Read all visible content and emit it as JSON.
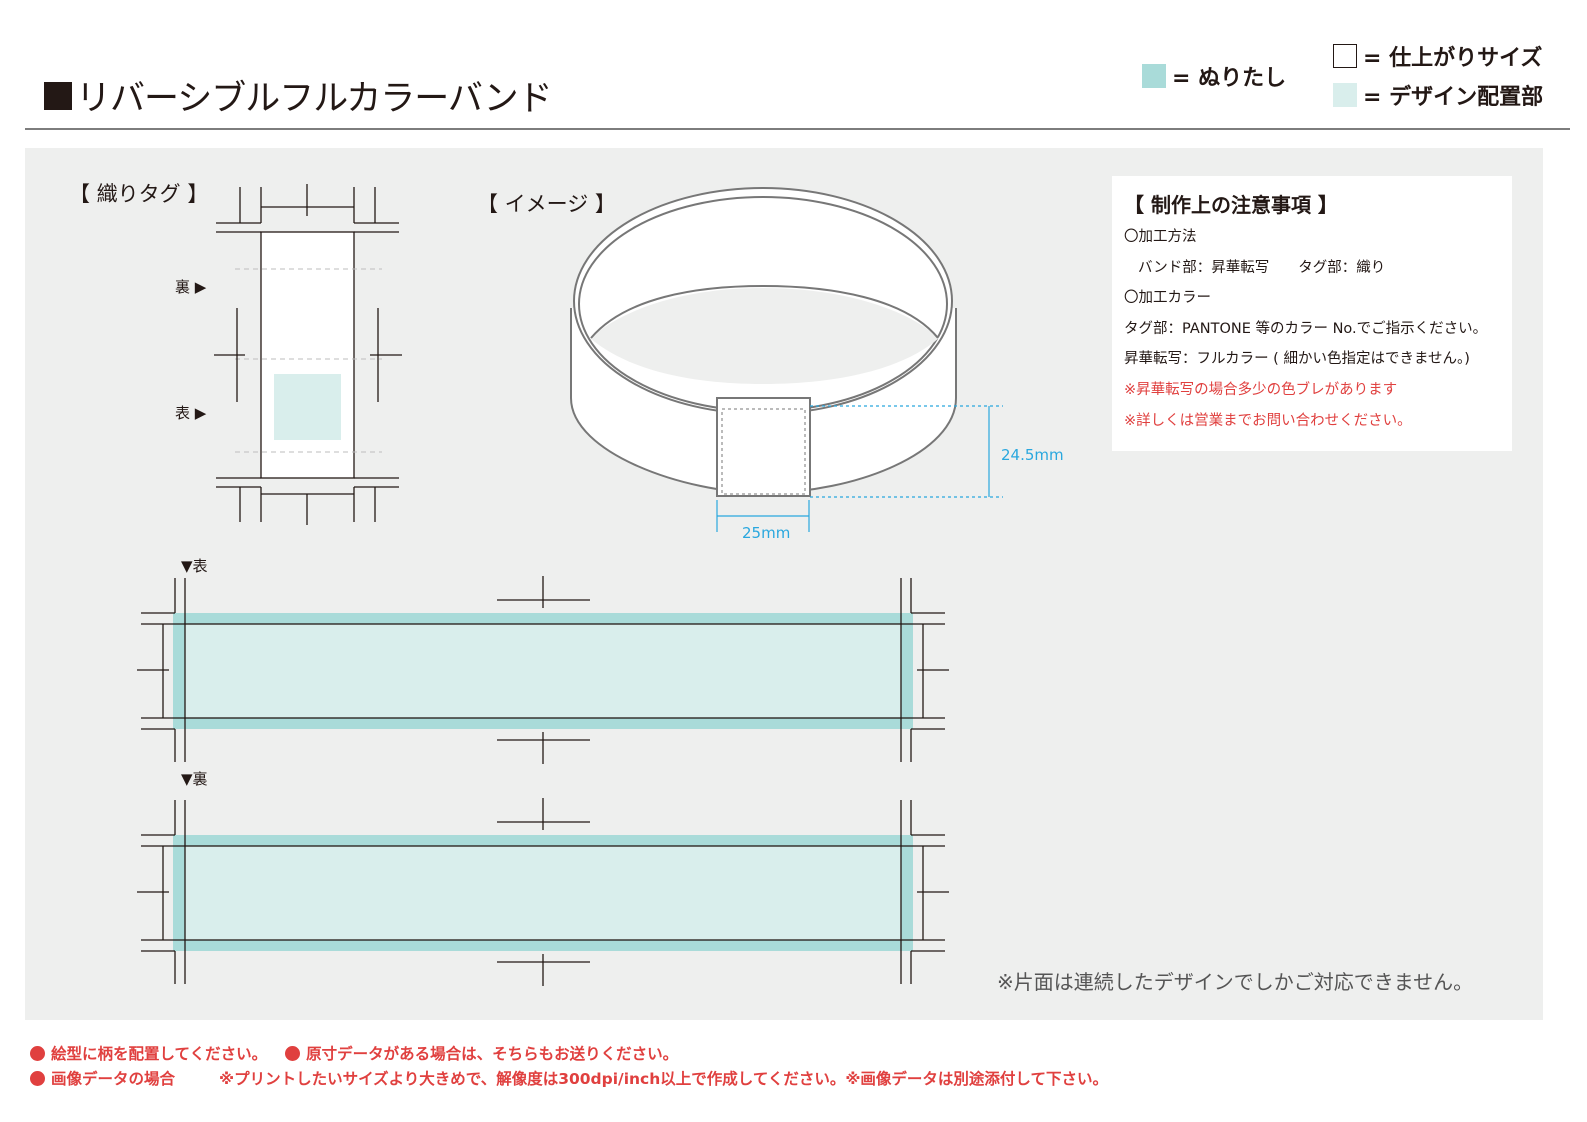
{
  "title": "リバーシブルフルカラーバンド",
  "legend": {
    "bleed": "= ぬりたし",
    "finish": "= 仕上がりサイズ",
    "design": "= デザイン配置部"
  },
  "colors": {
    "bleed": "#a9dbd9",
    "design": "#d9eeec",
    "panel": "#eeefee",
    "dimension": "#29a7de",
    "warning": "#e0403f"
  },
  "tag_section": {
    "title": "【 織りタグ 】",
    "back_label": "裏",
    "front_label": "表"
  },
  "image_section": {
    "title": "【 イメージ 】",
    "height_dim": "24.5mm",
    "width_dim": "25mm"
  },
  "notes": {
    "heading": "【 制作上の注意事項 】",
    "method_heading": "〇加工方法",
    "method_detail": "バンド部：昇華転写　　タグ部：織り",
    "color_heading": "〇加工カラー",
    "color_tag": "タグ部：PANTONE 等のカラー No.でご指示ください。",
    "color_sub": "昇華転写：フルカラー ( 細かい色指定はできません。)",
    "warn1": "※昇華転写の場合多少の色ブレがあります",
    "warn2": "※詳しくは営業までお問い合わせください。"
  },
  "bands": {
    "front_label": "▼表",
    "back_label": "▼裏"
  },
  "continuous_note": "※片面は連続したデザインでしかご対応できません。",
  "footer": {
    "line1a": "絵型に柄を配置してください。",
    "line1b": "原寸データがある場合は、そちらもお送りください。",
    "line2a": "画像データの場合",
    "line2b": "※プリントしたいサイズより大きめで、解像度は300dpi/inch以上で作成してください。※画像データは別途添付して下さい。"
  }
}
